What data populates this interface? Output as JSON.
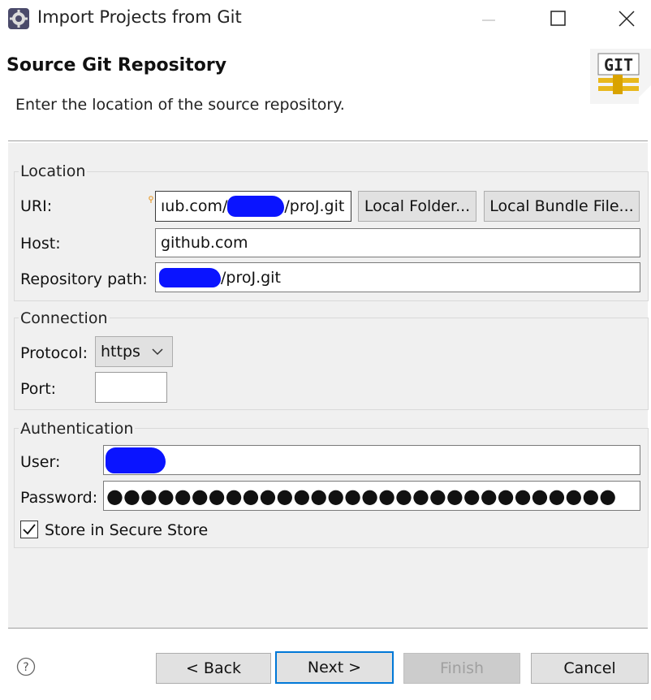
{
  "window": {
    "title": "Import Projects from Git",
    "icon": "eclipse-gear-icon"
  },
  "header": {
    "title": "Source Git Repository",
    "description": "Enter the location of the source repository.",
    "logo_text": "GIT"
  },
  "location": {
    "group_title": "Location",
    "uri_label": "URI:",
    "uri_value_start": "ıub.com/",
    "uri_value_end": "/proJ.git",
    "local_folder_button": "Local Folder...",
    "local_bundle_button": "Local Bundle File...",
    "host_label": "Host:",
    "host_value": "github.com",
    "repo_path_label": "Repository path:",
    "repo_path_value_end": "/proJ.git"
  },
  "connection": {
    "group_title": "Connection",
    "protocol_label": "Protocol:",
    "protocol_value": "https",
    "port_label": "Port:",
    "port_value": ""
  },
  "authentication": {
    "group_title": "Authentication",
    "user_label": "User:",
    "password_label": "Password:",
    "password_mask": "●●●●●●●●●●●●●●●●●●●●●●●●●●●●●●",
    "store_label": "Store in Secure Store",
    "store_checked": true
  },
  "footer": {
    "back_button": "< Back",
    "next_button": "Next >",
    "finish_button": "Finish",
    "cancel_button": "Cancel"
  },
  "colors": {
    "accent": "#0078d7",
    "redaction": "#0a14ff",
    "panel_bg": "#f0f0f0"
  }
}
